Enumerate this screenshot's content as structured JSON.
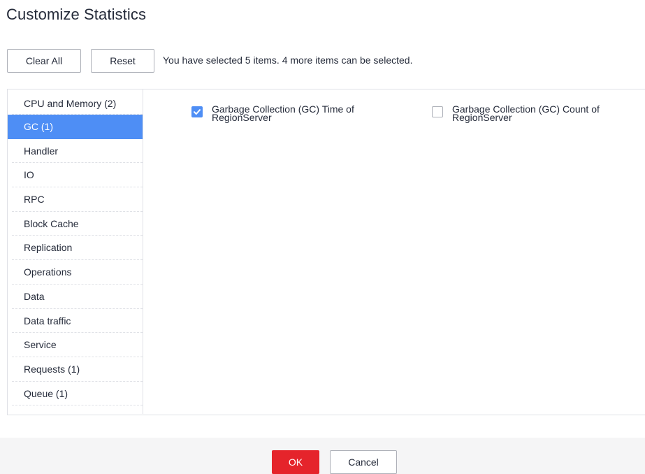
{
  "dialog": {
    "title": "Customize Statistics"
  },
  "toolbar": {
    "clear_all_label": "Clear All",
    "reset_label": "Reset",
    "selection_info": "You have selected 5 items. 4 more items can be selected."
  },
  "categories": [
    {
      "label": "CPU and Memory (2)",
      "active": false
    },
    {
      "label": "GC (1)",
      "active": true
    },
    {
      "label": "Handler",
      "active": false
    },
    {
      "label": "IO",
      "active": false
    },
    {
      "label": "RPC",
      "active": false
    },
    {
      "label": "Block Cache",
      "active": false
    },
    {
      "label": "Replication",
      "active": false
    },
    {
      "label": "Operations",
      "active": false
    },
    {
      "label": "Data",
      "active": false
    },
    {
      "label": "Data traffic",
      "active": false
    },
    {
      "label": "Service",
      "active": false
    },
    {
      "label": "Requests (1)",
      "active": false
    },
    {
      "label": "Queue (1)",
      "active": false
    }
  ],
  "metrics": [
    {
      "label_line1": "Garbage Collection (GC) Time of",
      "label_line2": "RegionServer",
      "checked": true
    },
    {
      "label_line1": "Garbage Collection (GC) Count of",
      "label_line2": "RegionServer",
      "checked": false
    }
  ],
  "footer": {
    "ok_label": "OK",
    "cancel_label": "Cancel"
  },
  "colors": {
    "accent": "#4e8ef5",
    "primary_button": "#e5242b",
    "text": "#252b3a",
    "border": "#dfe1e6"
  },
  "icons": {
    "checkbox_checked": "checkmark-icon"
  }
}
